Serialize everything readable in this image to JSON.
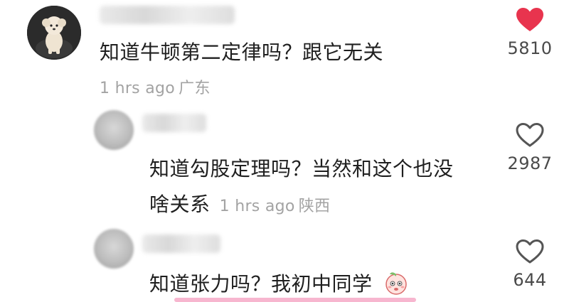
{
  "comments": [
    {
      "text": "知道牛顿第二定律吗？跟它无关",
      "time": "1 hrs ago",
      "location": "广东",
      "likes": "5810",
      "liked": true
    },
    {
      "text_line1": "知道勾股定理吗？当然和这个也没",
      "text_line2": "啥关系",
      "time": "1 hrs ago",
      "location": "陕西",
      "likes": "2987",
      "liked": false
    },
    {
      "text": "知道张力吗？我初中同学",
      "likes": "644",
      "liked": false,
      "emoji": "peach-face-emoji"
    }
  ],
  "colors": {
    "liked_heart": "#e8344e",
    "heart_outline": "#555555",
    "meta_text": "#a3a3a3"
  },
  "icons": {
    "liked": "filled-heart-icon",
    "unliked": "outline-heart-icon"
  }
}
